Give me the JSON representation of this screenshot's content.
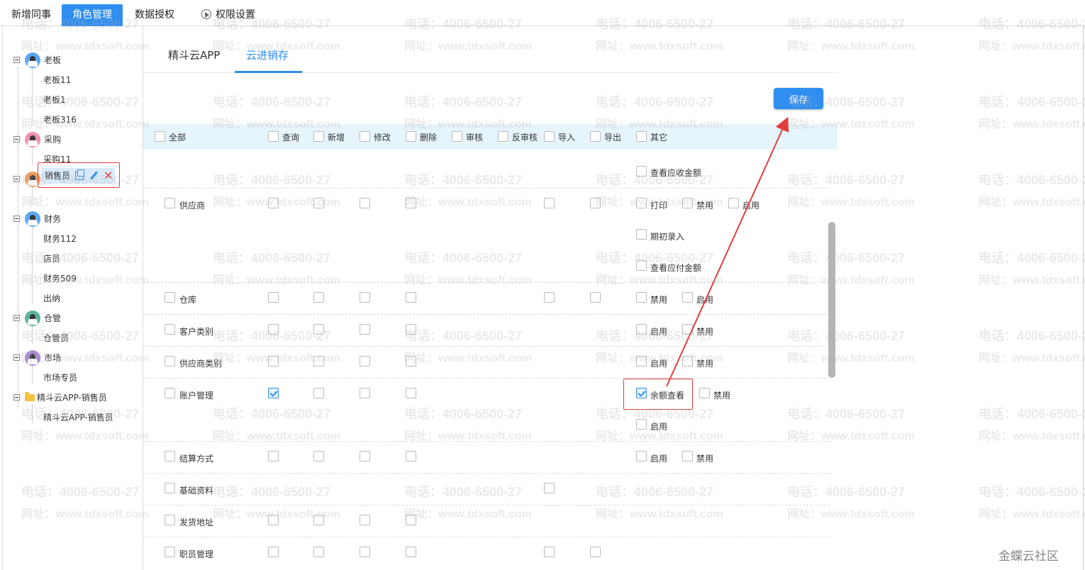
{
  "top_nav": {
    "tabs": [
      "新增同事",
      "角色管理",
      "数据授权",
      "权限设置"
    ],
    "active": "角色管理"
  },
  "tree": [
    {
      "label": "老板",
      "type": "group",
      "avatar_color": "#5aa9f5"
    },
    {
      "label": "老板11",
      "type": "leaf"
    },
    {
      "label": "老板1",
      "type": "leaf"
    },
    {
      "label": "老板316",
      "type": "leaf"
    },
    {
      "label": "采购",
      "type": "group",
      "avatar_color": "#f291b2"
    },
    {
      "label": "采购11",
      "type": "leaf"
    },
    {
      "label": "销售",
      "type": "group",
      "avatar_color": "#f29b5a"
    },
    {
      "label": "销售员",
      "type": "selected"
    },
    {
      "label": "财务",
      "type": "group",
      "avatar_color": "#5aa9f5"
    },
    {
      "label": "财务112",
      "type": "leaf"
    },
    {
      "label": "店员",
      "type": "leaf"
    },
    {
      "label": "财务509",
      "type": "leaf"
    },
    {
      "label": "出纳",
      "type": "leaf"
    },
    {
      "label": "仓管",
      "type": "group",
      "avatar_color": "#58b59a"
    },
    {
      "label": "仓管员",
      "type": "leaf"
    },
    {
      "label": "市场",
      "type": "group",
      "avatar_color": "#a98ad9"
    },
    {
      "label": "市场专员",
      "type": "leaf"
    },
    {
      "label": "精斗云APP-销售员",
      "type": "folder"
    },
    {
      "label": "精斗云APP-销售员",
      "type": "leaf"
    }
  ],
  "sub_tabs": [
    "精斗云APP",
    "云进销存"
  ],
  "active_sub_tab": "云进销存",
  "save_label": "保存",
  "header_cols": [
    "全部",
    "查询",
    "新增",
    "修改",
    "删除",
    "审核",
    "反审核",
    "导入",
    "导出",
    "其它"
  ],
  "rows": [
    {
      "name": "",
      "others": [
        [
          "查看应收金额"
        ]
      ]
    },
    {
      "name": "供应商",
      "cols": [
        "查询",
        "新增",
        "修改",
        "删除",
        "导入",
        "导出"
      ],
      "others": [
        [
          "打印",
          "禁用",
          "启用"
        ],
        [
          "期初录入"
        ],
        [
          "查看应付金额"
        ]
      ]
    },
    {
      "name": "仓库",
      "cols": [
        "查询",
        "新增",
        "修改",
        "删除",
        "导入",
        "导出"
      ],
      "others": [
        [
          "禁用",
          "启用"
        ]
      ]
    },
    {
      "name": "客户类别",
      "cols": [
        "查询",
        "新增",
        "修改",
        "删除"
      ],
      "others": [
        [
          "启用",
          "禁用"
        ]
      ]
    },
    {
      "name": "供应商类别",
      "cols": [
        "查询",
        "新增",
        "修改",
        "删除"
      ],
      "others": [
        [
          "启用",
          "禁用"
        ]
      ]
    },
    {
      "name": "账户管理",
      "cols": [
        "查询",
        "新增",
        "修改",
        "删除"
      ],
      "checked": [
        "查询"
      ],
      "others": [
        [
          "余额查看",
          "禁用"
        ],
        [
          "启用"
        ]
      ],
      "others_checked": [
        "余额查看"
      ]
    },
    {
      "name": "结算方式",
      "cols": [
        "查询",
        "新增",
        "修改",
        "删除"
      ],
      "others": [
        [
          "启用",
          "禁用"
        ]
      ]
    },
    {
      "name": "基础资料",
      "cols": [
        "导入"
      ],
      "others": []
    },
    {
      "name": "发货地址",
      "cols": [
        "查询",
        "新增",
        "修改",
        "删除"
      ],
      "others": []
    },
    {
      "name": "职员管理",
      "cols": [
        "查询",
        "新增",
        "修改",
        "删除",
        "导入",
        "导出"
      ],
      "others": []
    }
  ],
  "watermark": {
    "phone": "电话：4006-6500-27",
    "site": "网址：www.tdxsoft.com"
  },
  "brand": "金蝶云社区",
  "colors": {
    "accent": "#2f8ef0",
    "highlight": "#e23d3d",
    "header_bg": "#e6f4fc"
  }
}
